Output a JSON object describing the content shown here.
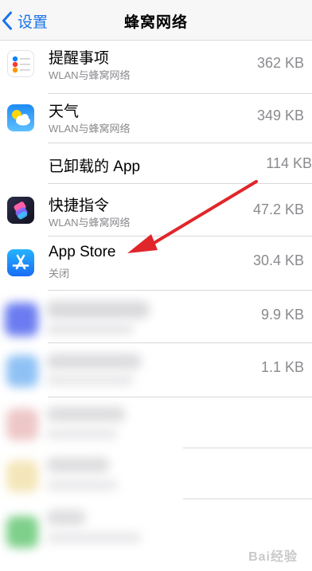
{
  "nav": {
    "back_label": "设置",
    "title": "蜂窝网络"
  },
  "apps": [
    {
      "name": "提醒事项",
      "subtitle": "WLAN与蜂窝网络",
      "size": "362 KB",
      "icon": "reminders-icon"
    },
    {
      "name": "天气",
      "subtitle": "WLAN与蜂窝网络",
      "size": "349 KB",
      "icon": "weather-icon"
    },
    {
      "name": "已卸载的 App",
      "subtitle": "",
      "size": "114 KB",
      "icon": ""
    },
    {
      "name": "快捷指令",
      "subtitle": "WLAN与蜂窝网络",
      "size": "47.2 KB",
      "icon": "shortcuts-icon"
    },
    {
      "name": "App Store",
      "subtitle": "关闭",
      "size": "30.4 KB",
      "icon": "app-store-icon"
    },
    {
      "name": "",
      "subtitle": "",
      "size": "9.9 KB",
      "icon": "blurred-app-icon"
    },
    {
      "name": "",
      "subtitle": "",
      "size": "1.1 KB",
      "icon": "blurred-app-icon"
    }
  ],
  "watermark": "Bai经验",
  "colors": {
    "accent": "#1a73e8",
    "annotation_arrow": "#e0262b"
  }
}
